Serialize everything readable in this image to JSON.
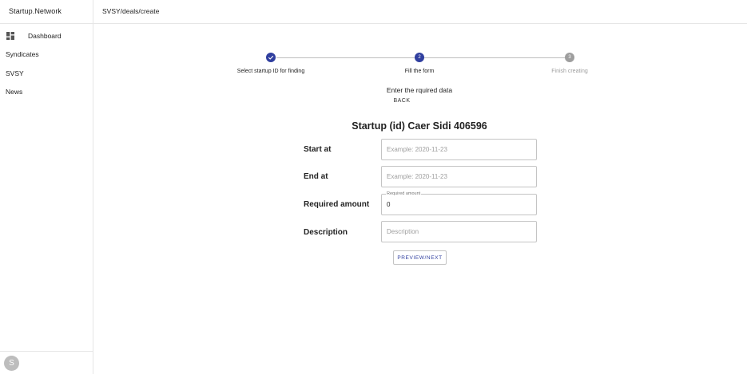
{
  "app": {
    "brand": "Startup.Network"
  },
  "header": {
    "breadcrumb": "SVSY/deals/create"
  },
  "sidebar": {
    "items": [
      {
        "label": "Dashboard",
        "icon": "dashboard-icon"
      },
      {
        "label": "Syndicates"
      },
      {
        "label": "SVSY"
      },
      {
        "label": "News"
      }
    ],
    "avatar": "S"
  },
  "stepper": {
    "steps": [
      {
        "label": "Select startup ID for finding",
        "state": "done",
        "marker": "check-icon"
      },
      {
        "label": "Fill the form",
        "state": "current",
        "marker": "2"
      },
      {
        "label": "Finish creating",
        "state": "pending",
        "marker": "3"
      }
    ],
    "active_color": "#303f9f",
    "inactive_color": "#9e9e9e"
  },
  "main": {
    "subtitle": "Enter the rquired data",
    "back_label": "BACK",
    "title": "Startup (id) Caer Sidi 406596",
    "form": {
      "start_at": {
        "label": "Start at",
        "placeholder": "Example: 2020-11-23",
        "value": ""
      },
      "end_at": {
        "label": "End at",
        "placeholder": "Example: 2020-11-23",
        "value": ""
      },
      "required_amount": {
        "label": "Required amount",
        "floating_label": "Required amount",
        "value": "0"
      },
      "description": {
        "label": "Description",
        "placeholder": "Description",
        "value": ""
      }
    },
    "preview_label": "PREVIEW/NEXT"
  }
}
